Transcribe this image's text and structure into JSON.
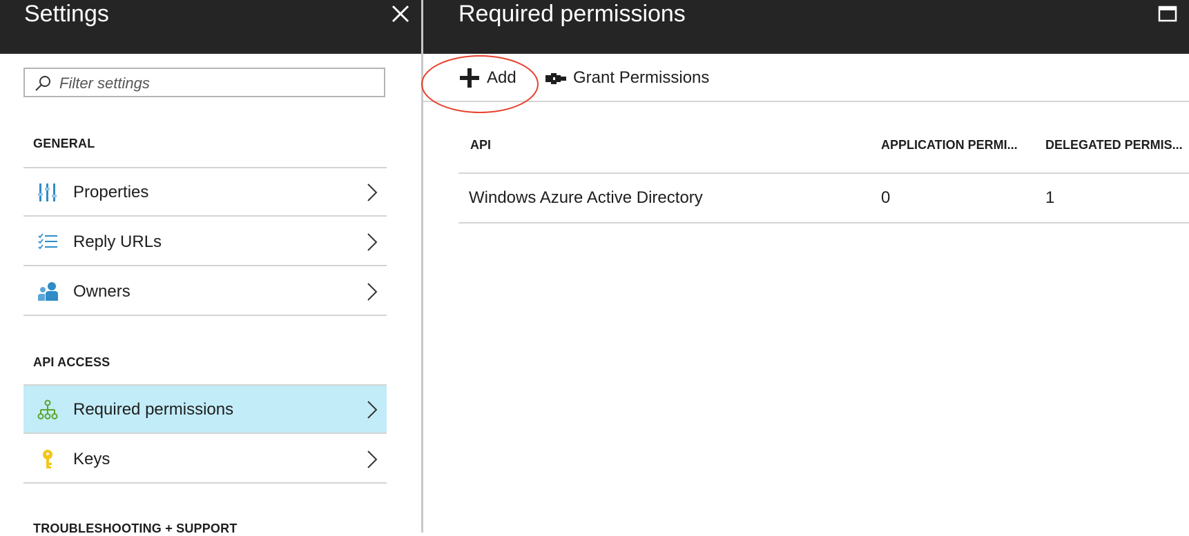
{
  "settings": {
    "title": "Settings",
    "filter_placeholder": "Filter settings",
    "sections": [
      {
        "header": "GENERAL",
        "items": [
          {
            "label": "Properties",
            "icon": "properties-icon"
          },
          {
            "label": "Reply URLs",
            "icon": "checklist-icon"
          },
          {
            "label": "Owners",
            "icon": "owners-icon"
          }
        ]
      },
      {
        "header": "API ACCESS",
        "items": [
          {
            "label": "Required permissions",
            "icon": "hierarchy-icon",
            "selected": true
          },
          {
            "label": "Keys",
            "icon": "key-icon"
          }
        ]
      },
      {
        "header": "TROUBLESHOOTING + SUPPORT",
        "items": []
      }
    ]
  },
  "permissions": {
    "title": "Required permissions",
    "toolbar": {
      "add_label": "Add",
      "grant_label": "Grant Permissions"
    },
    "columns": [
      "API",
      "APPLICATION PERMI...",
      "DELEGATED PERMIS..."
    ],
    "rows": [
      {
        "api": "Windows Azure Active Directory",
        "application": "0",
        "delegated": "1"
      }
    ]
  },
  "colors": {
    "header_bg": "#252525",
    "selected_bg": "#c2ecf8",
    "annotation_red": "#e8412c",
    "icon_blue": "#2f8cc7",
    "icon_green": "#5aa52c",
    "icon_yellow": "#f5c518"
  }
}
